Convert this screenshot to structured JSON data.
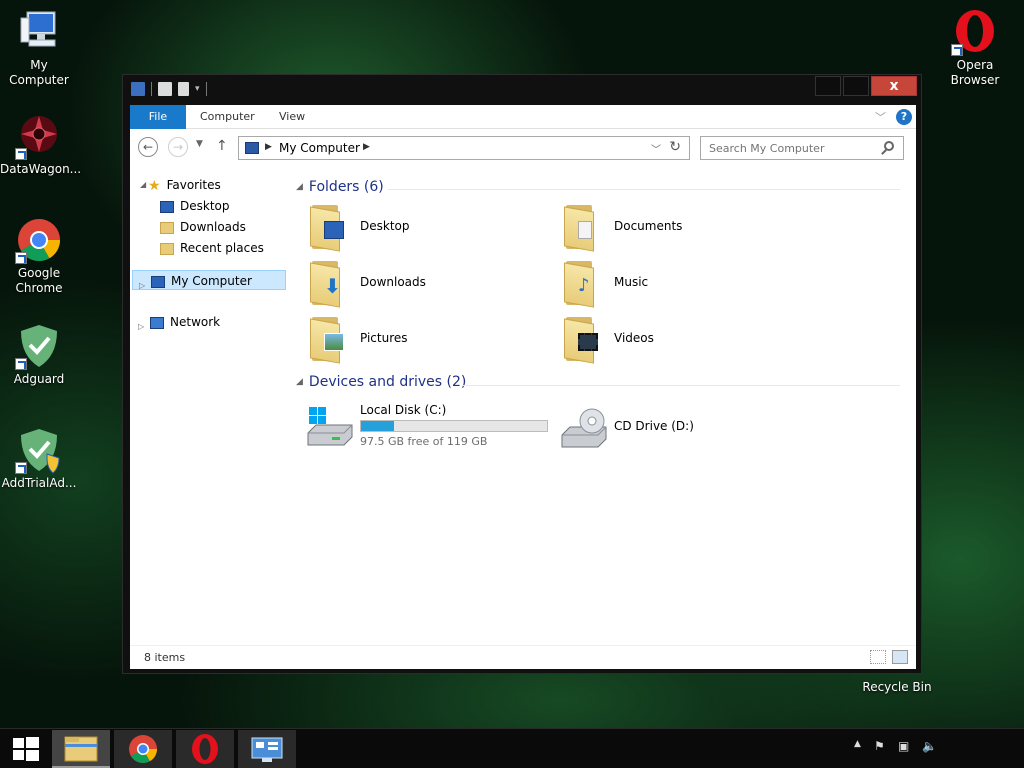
{
  "desktop": {
    "icons": [
      {
        "label": "My Computer"
      },
      {
        "label": "DataWagon..."
      },
      {
        "label": "Google Chrome"
      },
      {
        "label": "Adguard"
      },
      {
        "label": "AddTrialAd..."
      },
      {
        "label": "Opera Browser"
      },
      {
        "label": "Recycle Bin"
      }
    ]
  },
  "window": {
    "close_label": "x",
    "ribbon": {
      "tabs": [
        {
          "label": "File"
        },
        {
          "label": "Computer"
        },
        {
          "label": "View"
        }
      ],
      "help": "?"
    },
    "address": {
      "crumb": "My Computer"
    },
    "search": {
      "placeholder": "Search My Computer"
    },
    "nav_pane": {
      "favorites": "Favorites",
      "favorites_items": [
        {
          "label": "Desktop"
        },
        {
          "label": "Downloads"
        },
        {
          "label": "Recent places"
        }
      ],
      "my_computer": "My Computer",
      "network": "Network"
    },
    "folders_group": {
      "title": "Folders (6)",
      "items": [
        {
          "label": "Desktop"
        },
        {
          "label": "Documents"
        },
        {
          "label": "Downloads"
        },
        {
          "label": "Music"
        },
        {
          "label": "Pictures"
        },
        {
          "label": "Videos"
        }
      ]
    },
    "drives_group": {
      "title": "Devices and drives (2)",
      "drives": [
        {
          "name": "Local Disk (C:)",
          "free_text": "97.5 GB free of 119 GB",
          "used_fraction": 0.18
        },
        {
          "name": "CD Drive (D:)"
        }
      ]
    },
    "status": {
      "item_count": "8 items"
    }
  },
  "colors": {
    "accent": "#1979ca",
    "group_header": "#1e3287",
    "progress_fill": "#26a0da",
    "close_button": "#c7463a"
  }
}
